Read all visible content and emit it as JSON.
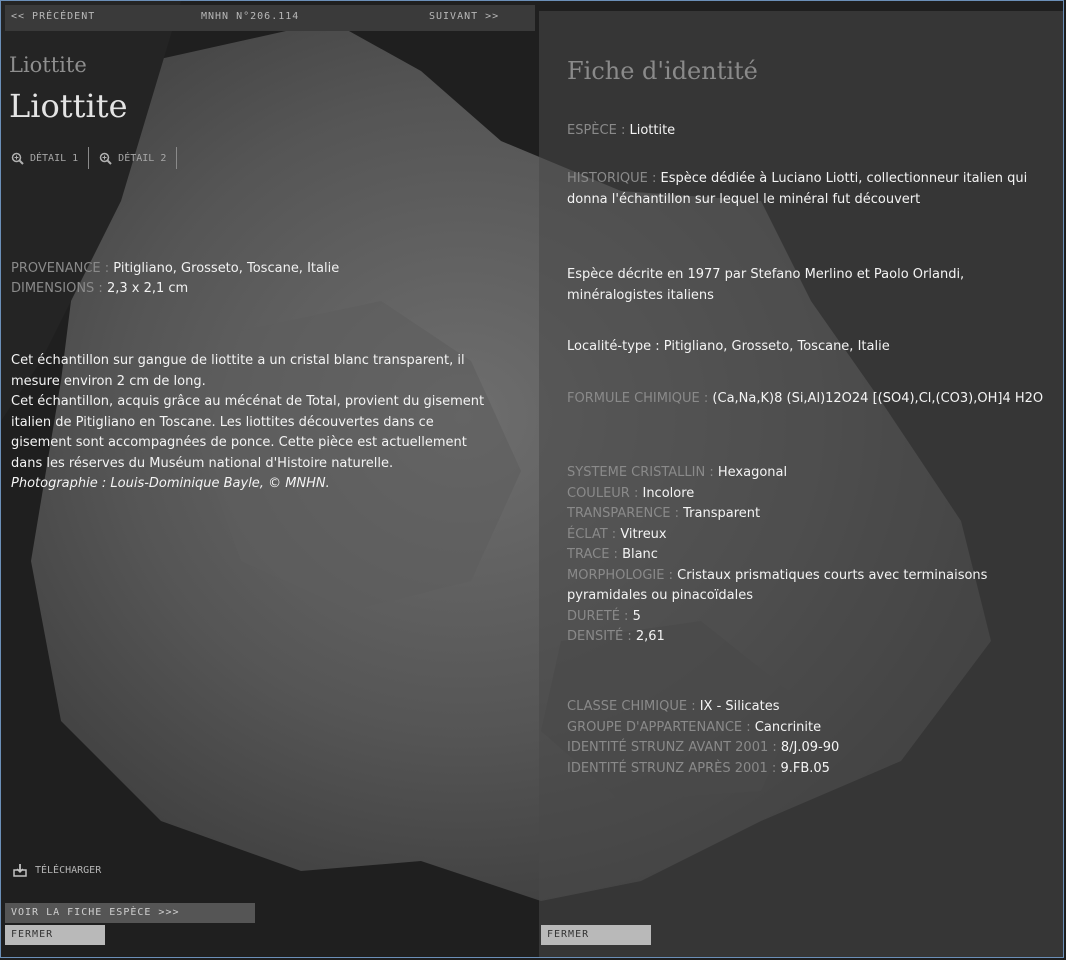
{
  "nav": {
    "prev_label": "<< PRÉCÉDENT",
    "catalog_number": "MNHN N°206.114",
    "next_label": "SUIVANT >>"
  },
  "specimen": {
    "scientific_name": "Liottite",
    "common_name": "Liottite",
    "detail1_label": "DÉTAIL 1",
    "detail2_label": "DÉTAIL 2",
    "provenance_key": "PROVENANCE :",
    "provenance_value": "Pitigliano, Grosseto, Toscane, Italie",
    "dimensions_key": "DIMENSIONS :",
    "dimensions_value": "2,3 x 2,1 cm",
    "description_lines": [
      "Cet échantillon sur gangue de liottite a un cristal blanc transparent, il mesure environ 2 cm de long.",
      "Cet échantillon, acquis grâce au mécénat de Total, provient du gisement italien de Pitigliano en Toscane. Les liottites découvertes dans ce gisement sont accompagnées de ponce. Cette pièce est actuellement dans les réserves du Muséum national d'Histoire naturelle."
    ],
    "credit": "Photographie : Louis-Dominique Bayle, © MNHN.",
    "download_label": "TÉLÉCHARGER",
    "species_sheet_button": "VOIR LA FICHE ESPÈCE  >>>",
    "close_label": "FERMER"
  },
  "fiche": {
    "title": "Fiche d'identité",
    "espece_key": "ESPÈCE :",
    "espece_value": "Liottite",
    "historique_key": "HISTORIQUE :",
    "historique_value": "Espèce dédiée à Luciano Liotti, collectionneur italien qui donna l'échantillon sur lequel le minéral fut découvert",
    "description_year": "Espèce décrite en 1977 par Stefano Merlino et Paolo Orlandi, minéralogistes italiens",
    "localite": "Localité-type : Pitigliano, Grosseto, Toscane, Italie",
    "formule_key": "FORMULE CHIMIQUE :",
    "formule_value": "(Ca,Na,K)8 (Si,Al)12O24 [(SO4),Cl,(CO3),OH]4 H2O",
    "systeme_key": "SYSTEME CRISTALLIN :",
    "systeme_value": "Hexagonal",
    "couleur_key": "COULEUR :",
    "couleur_value": "Incolore",
    "transparence_key": "TRANSPARENCE :",
    "transparence_value": "Transparent",
    "eclat_key": "ÉCLAT :",
    "eclat_value": "Vitreux",
    "trace_key": "TRACE :",
    "trace_value": "Blanc",
    "morphologie_key": "MORPHOLOGIE :",
    "morphologie_value": "Cristaux prismatiques courts avec terminaisons pyramidales ou pinacoïdales",
    "durete_key": "DURETÉ :",
    "durete_value": "5",
    "densite_key": "DENSITÉ :",
    "densite_value": "2,61",
    "classe_key": "CLASSE CHIMIQUE :",
    "classe_value": "IX - Silicates",
    "groupe_key": "GROUPE D'APPARTENANCE :",
    "groupe_value": "Cancrinite",
    "strunz_avant_key": "IDENTITÉ STRUNZ AVANT 2001 :",
    "strunz_avant_value": "8/J.09-90",
    "strunz_apres_key": "IDENTITÉ STRUNZ APRÈS 2001 :",
    "strunz_apres_value": "9.FB.05",
    "close_label": "FERMER"
  },
  "colors": {
    "frame": "#6b8fb8",
    "label_gray": "#8a8a8a",
    "text_white": "#f4f4f4"
  }
}
